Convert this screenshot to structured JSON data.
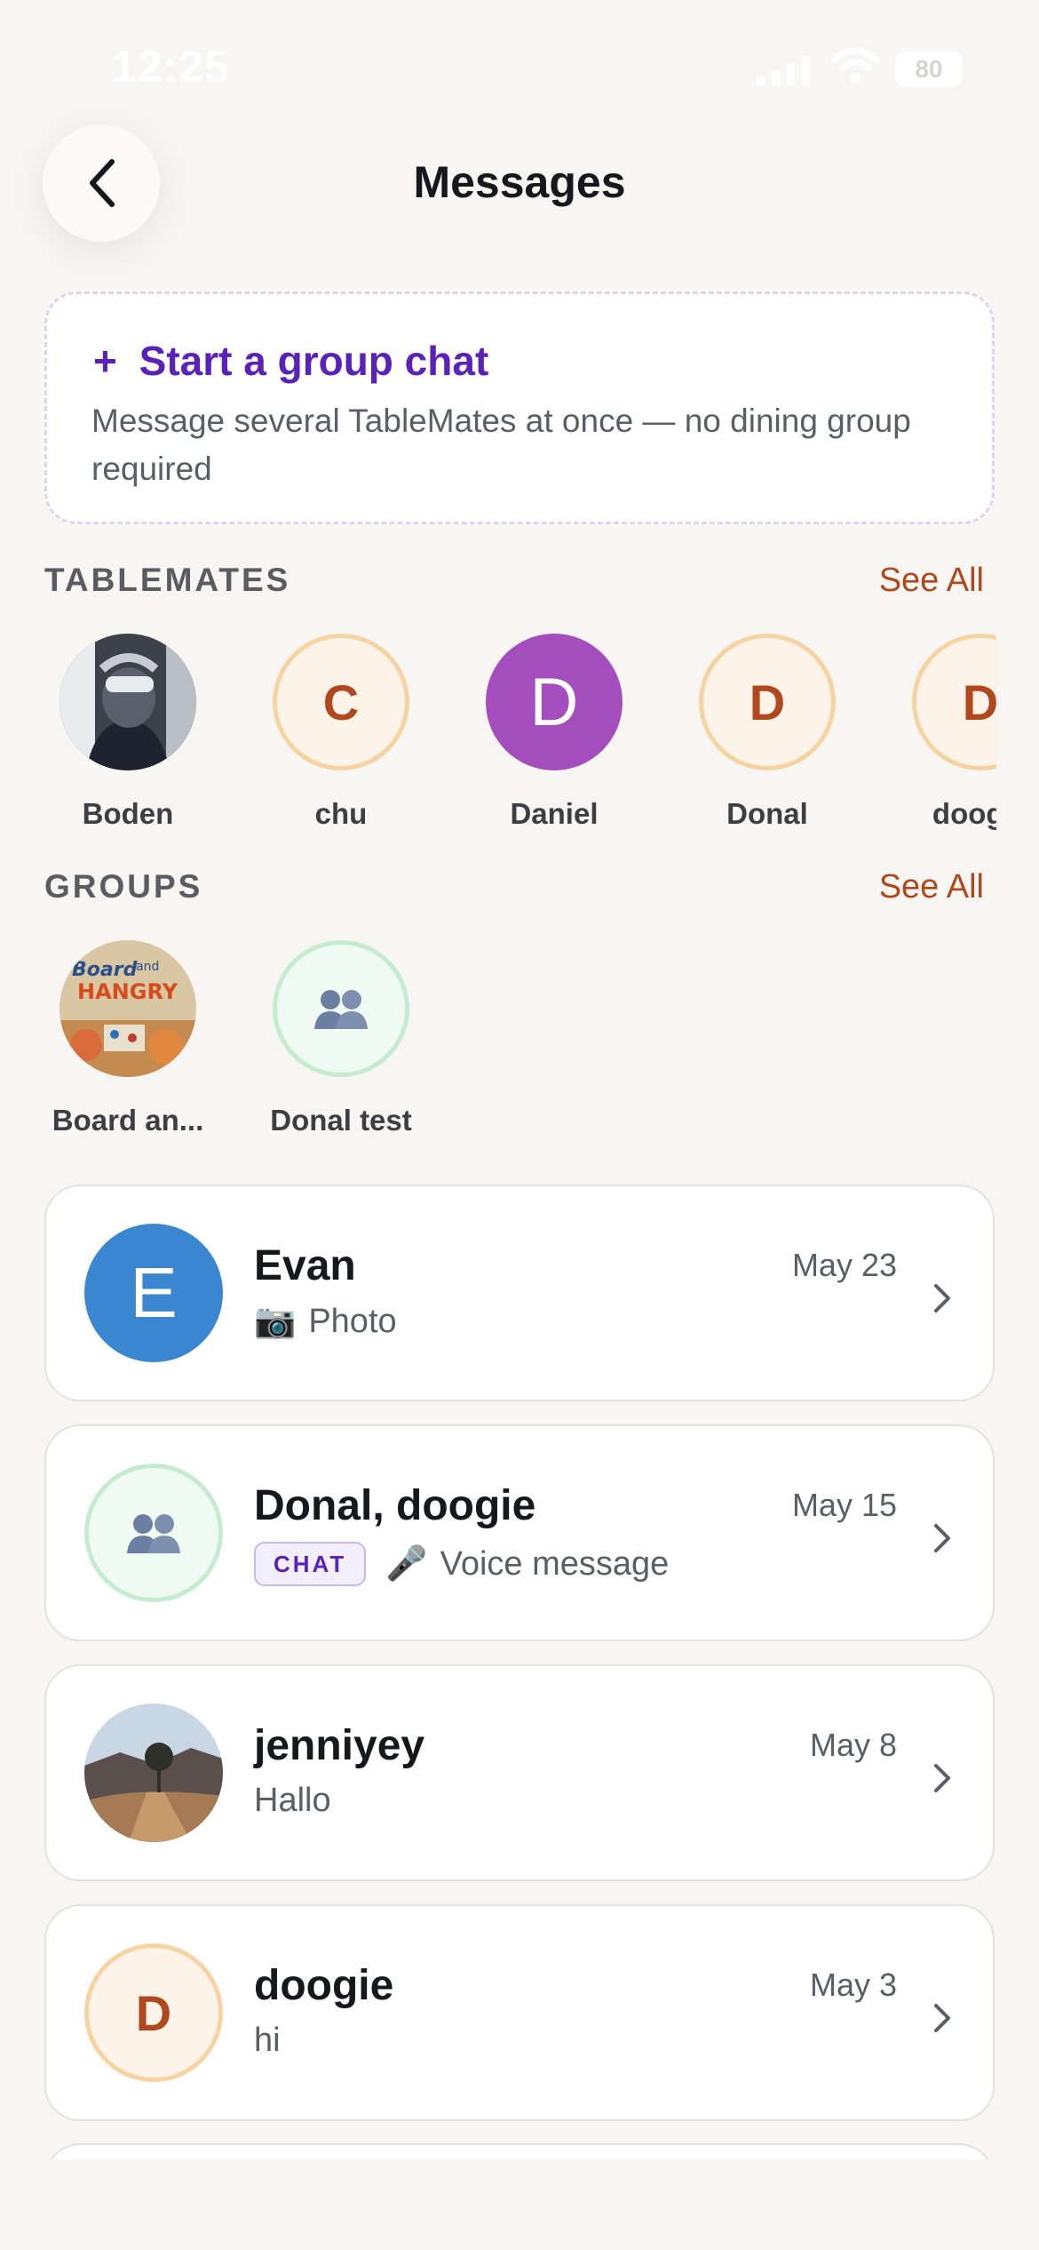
{
  "status_bar": {
    "time": "12:25",
    "battery": "80"
  },
  "header": {
    "title": "Messages"
  },
  "group_chat_card": {
    "plus": "+",
    "title": "Start a group chat",
    "description": "Message several TableMates at once — no dining group required"
  },
  "tablemates": {
    "heading": "TABLEMATES",
    "see_all": "See All",
    "items": [
      {
        "name": "Boden",
        "initial": ""
      },
      {
        "name": "chu",
        "initial": "C"
      },
      {
        "name": "Daniel",
        "initial": "D"
      },
      {
        "name": "Donal",
        "initial": "D"
      },
      {
        "name": "doogie",
        "initial": "D"
      }
    ]
  },
  "groups": {
    "heading": "GROUPS",
    "see_all": "See All",
    "items": [
      {
        "name": "Board an...",
        "logo_line1": "Board",
        "logo_and": "and",
        "logo_line2": "HANGRY"
      },
      {
        "name": "Donal test"
      }
    ]
  },
  "conversations": [
    {
      "name": "Evan",
      "date": "May 23",
      "initial": "E",
      "preview_icon": "📷",
      "preview": "Photo"
    },
    {
      "name": "Donal, doogie",
      "date": "May 15",
      "badge": "CHAT",
      "preview_icon": "🎤",
      "preview": "Voice message"
    },
    {
      "name": "jenniyey",
      "date": "May 8",
      "preview": "Hallo"
    },
    {
      "name": "doogie",
      "date": "May 3",
      "initial": "D",
      "preview": "hi"
    }
  ],
  "colors": {
    "background": "#f8f6f2",
    "accent_purple": "#5a22b7",
    "accent_orange": "#b0471d",
    "avatar_blue": "#3b86d1",
    "avatar_purple": "#a44ebd"
  }
}
